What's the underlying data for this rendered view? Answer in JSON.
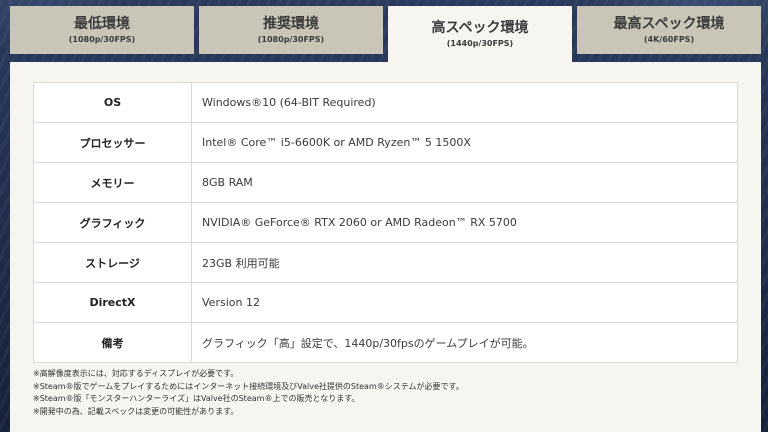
{
  "tabs": [
    {
      "title": "最低環境",
      "sub": "(1080p/30FPS)",
      "active": false
    },
    {
      "title": "推奨環境",
      "sub": "(1080p/30FPS)",
      "active": false
    },
    {
      "title": "高スペック環境",
      "sub": "(1440p/30FPS)",
      "active": true
    },
    {
      "title": "最高スペック環境",
      "sub": "(4K/60FPS)",
      "active": false
    }
  ],
  "specs": [
    {
      "label": "OS",
      "value": "Windows®10 (64-BIT Required)"
    },
    {
      "label": "プロセッサー",
      "value": "Intel® Core™ i5-6600K or AMD Ryzen™ 5 1500X"
    },
    {
      "label": "メモリー",
      "value": "8GB RAM"
    },
    {
      "label": "グラフィック",
      "value": "NVIDIA® GeForce® RTX 2060 or AMD Radeon™ RX 5700"
    },
    {
      "label": "ストレージ",
      "value": "23GB 利用可能"
    },
    {
      "label": "DirectX",
      "value": "Version 12"
    },
    {
      "label": "備考",
      "value": "グラフィック「高」設定で、1440p/30fpsのゲームプレイが可能。"
    }
  ],
  "notes": [
    "※高解像度表示には、対応するディスプレイが必要です。",
    "※Steam®版でゲームをプレイするためにはインターネット接続環境及びValve社提供のSteam®システムが必要です。",
    "※Steam®版「モンスターハンターライズ」はValve社のSteam®上での販売となります。",
    "※開発中の為、記載スペックは変更の可能性があります。"
  ]
}
